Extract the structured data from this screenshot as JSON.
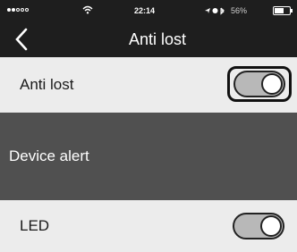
{
  "status_bar": {
    "time": "22:14",
    "battery": "56%"
  },
  "nav": {
    "title": "Anti lost"
  },
  "settings": {
    "anti_lost": {
      "label": "Anti lost",
      "enabled": true
    },
    "device_alert": {
      "label": "Device alert"
    },
    "led": {
      "label": "LED",
      "enabled": true
    }
  },
  "colors": {
    "header_bg": "#1e1e1e",
    "section_bg": "#505050",
    "row_bg": "#ececec"
  }
}
